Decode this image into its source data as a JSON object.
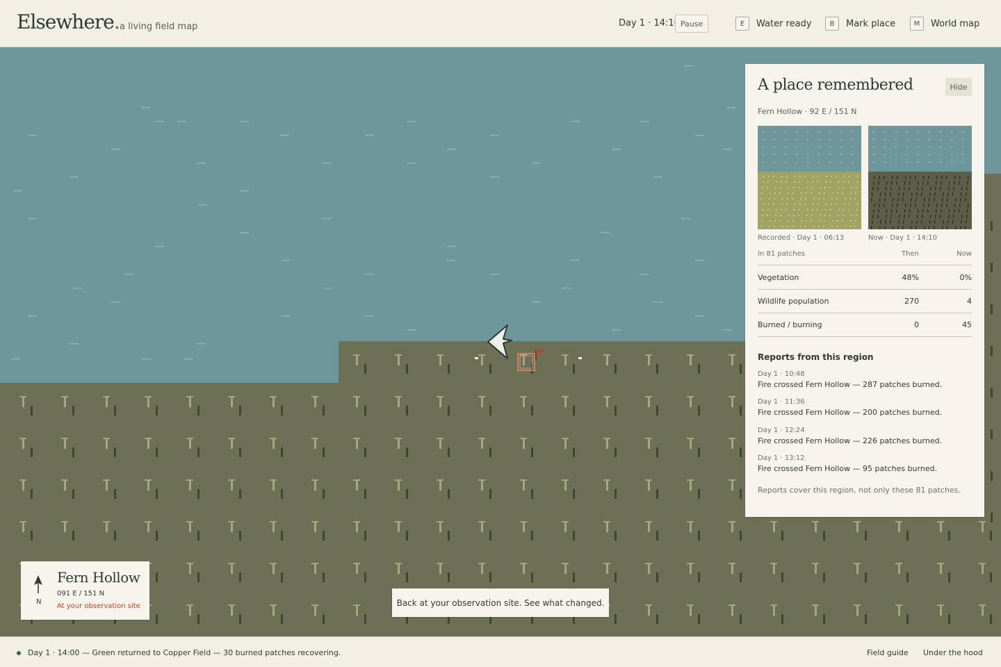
{
  "header": {
    "logo": "Elsewhere",
    "logo_dot": ".",
    "tagline": "a living field map",
    "clock": "Day 1 · 14:10",
    "pause_label": "Pause",
    "shortcuts": [
      {
        "key": "E",
        "label": "Water ready"
      },
      {
        "key": "B",
        "label": "Mark place"
      },
      {
        "key": "M",
        "label": "World map"
      }
    ]
  },
  "map": {
    "colors": {
      "water": "#6f969b",
      "burned": "#6e7056",
      "vegetation": "#a0a364",
      "marker": "#d4815f",
      "flag": "#b5452d"
    },
    "icons": [
      "bird-cursor-icon",
      "observation-marker-icon",
      "flag-icon"
    ]
  },
  "panel": {
    "title": "A place remembered",
    "hide_label": "Hide",
    "subtitle": "Fern Hollow · 92 E / 151 N",
    "recorded_caption": "Recorded · Day 1 · 06:13",
    "now_caption": "Now · Day 1 · 14:10",
    "stats_header": {
      "label": "In 81 patches",
      "then": "Then",
      "now": "Now"
    },
    "stats": [
      {
        "label": "Vegetation",
        "then": "48%",
        "now": "0%"
      },
      {
        "label": "Wildlife population",
        "then": "270",
        "now": "4"
      },
      {
        "label": "Burned / burning",
        "then": "0",
        "now": "45"
      }
    ],
    "reports_title": "Reports from this region",
    "reports": [
      {
        "time": "Day 1 · 10:48",
        "text": "Fire crossed Fern Hollow — 287 patches burned."
      },
      {
        "time": "Day 1 · 11:36",
        "text": "Fire crossed Fern Hollow — 200 patches burned."
      },
      {
        "time": "Day 1 · 12:24",
        "text": "Fire crossed Fern Hollow — 226 patches burned."
      },
      {
        "time": "Day 1 · 13:12",
        "text": "Fire crossed Fern Hollow — 95 patches burned."
      }
    ],
    "reports_note": "Reports cover this region, not only these 81 patches."
  },
  "location": {
    "north": "N",
    "name": "Fern Hollow",
    "coords": "091 E / 151 N",
    "status": "At your observation site"
  },
  "toast": "Back at your observation site. See what changed.",
  "footer": {
    "event": "Day 1 · 14:00 — Green returned to Copper Field — 30 burned patches recovering.",
    "links": [
      "Field guide",
      "Under the hood"
    ]
  }
}
